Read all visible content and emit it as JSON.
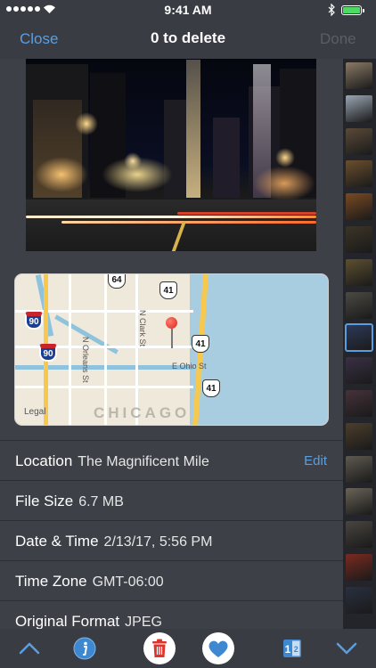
{
  "status_bar": {
    "time": "9:41 AM"
  },
  "nav": {
    "close_label": "Close",
    "title": "0 to delete",
    "done_label": "Done"
  },
  "map": {
    "city_label": "CHICAGO",
    "legal_label": "Legal",
    "street_labels": [
      "N Orleans St",
      "N Clark St",
      "E Ohio St"
    ],
    "shields": [
      "64",
      "41",
      "41",
      "41",
      "90",
      "90"
    ]
  },
  "details": {
    "location": {
      "label": "Location",
      "value": "The Magnificent Mile",
      "edit_label": "Edit"
    },
    "file_size": {
      "label": "File Size",
      "value": "6.7 MB"
    },
    "date_time": {
      "label": "Date & Time",
      "value": "2/13/17, 5:56 PM"
    },
    "time_zone": {
      "label": "Time Zone",
      "value": "GMT-06:00"
    },
    "original_format": {
      "label": "Original Format",
      "value": "JPEG"
    }
  },
  "thumbnails": {
    "count": 17,
    "selected_index": 8
  },
  "toolbar": {
    "icons": [
      "chevron-up-icon",
      "info-icon",
      "trash-icon",
      "heart-icon",
      "compare-icon",
      "chevron-down-icon"
    ],
    "compare_numbers": "1 2"
  },
  "colors": {
    "accent": "#5b9ee0",
    "background": "#3e4047",
    "delete": "#e0332c",
    "favorite": "#3d88d1"
  }
}
